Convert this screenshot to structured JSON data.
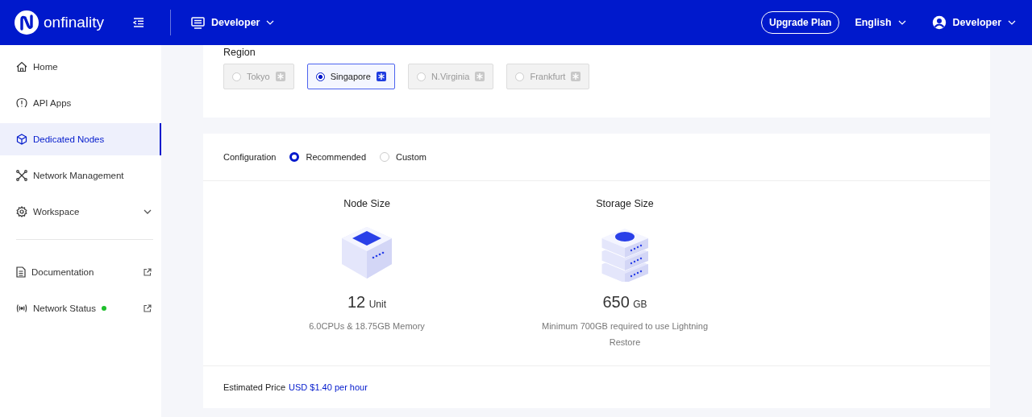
{
  "header": {
    "logo_text": "onfinality",
    "workspace": "Developer",
    "upgrade_button": "Upgrade Plan",
    "language": "English",
    "user": "Developer"
  },
  "sidebar": {
    "items": [
      {
        "label": "Home",
        "selected": false,
        "expandable": false
      },
      {
        "label": "API Apps",
        "selected": false,
        "expandable": false
      },
      {
        "label": "Dedicated Nodes",
        "selected": true,
        "expandable": false
      },
      {
        "label": "Network Management",
        "selected": false,
        "expandable": false
      },
      {
        "label": "Workspace",
        "selected": false,
        "expandable": true
      }
    ],
    "links": [
      {
        "label": "Documentation",
        "selected": false,
        "external": true
      },
      {
        "label": "Network Status",
        "selected": false,
        "external": true,
        "color": "#1fbf2c"
      }
    ]
  },
  "region": {
    "label": "Region",
    "options": [
      {
        "label": "Tokyo",
        "selected": false,
        "disabled": true
      },
      {
        "label": "Singapore",
        "selected": true,
        "disabled": false
      },
      {
        "label": "N.Virginia",
        "selected": false,
        "disabled": true
      },
      {
        "label": "Frankfurt",
        "selected": false,
        "disabled": true
      }
    ]
  },
  "configuration": {
    "label": "Configuration",
    "options": [
      {
        "label": "Recommended",
        "selected": true
      },
      {
        "label": "Custom",
        "selected": false
      }
    ],
    "sizes": [
      {
        "kind": "node",
        "title": "Node Size",
        "value": "12",
        "unit": "Unit",
        "description": "6.0CPUs & 18.75GB Memory"
      },
      {
        "kind": "storage",
        "title": "Storage Size",
        "value": "650",
        "unit": "GB",
        "description": "Minimum 700GB required to use Lightning Restore"
      }
    ],
    "price_label": "Estimated Price",
    "price": "USD $1.40 per hour"
  }
}
